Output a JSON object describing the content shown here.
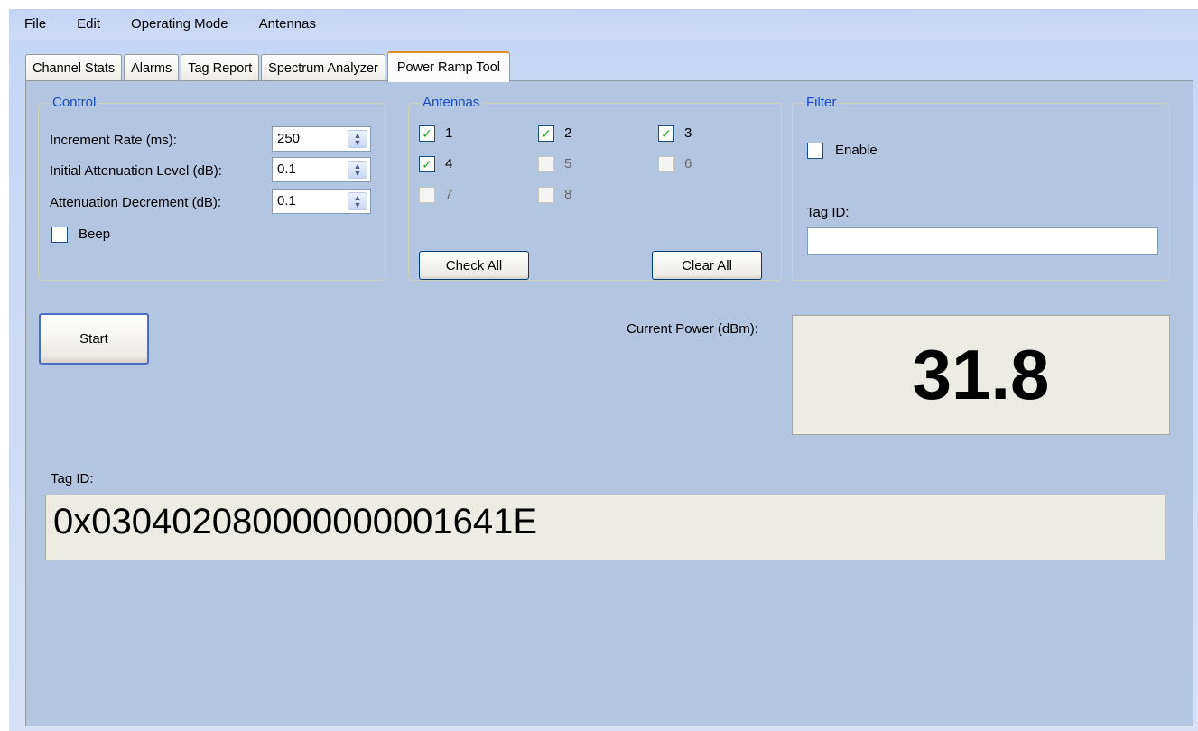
{
  "menu": [
    "File",
    "Edit",
    "Operating Mode",
    "Antennas"
  ],
  "tabs": [
    "Channel Stats",
    "Alarms",
    "Tag Report",
    "Spectrum Analyzer",
    "Power Ramp Tool"
  ],
  "control": {
    "title": "Control",
    "increment_rate_label": "Increment Rate (ms):",
    "increment_rate_value": "250",
    "initial_atten_label": "Initial Attenuation Level (dB):",
    "initial_atten_value": "0.1",
    "atten_decrement_label": "Attenuation Decrement (dB):",
    "atten_decrement_value": "0.1",
    "beep_label": "Beep"
  },
  "antennas": {
    "title": "Antennas",
    "items": [
      {
        "label": "1",
        "checked": true,
        "enabled": true
      },
      {
        "label": "2",
        "checked": true,
        "enabled": true
      },
      {
        "label": "3",
        "checked": true,
        "enabled": true
      },
      {
        "label": "4",
        "checked": true,
        "enabled": true
      },
      {
        "label": "5",
        "checked": false,
        "enabled": false
      },
      {
        "label": "6",
        "checked": false,
        "enabled": false
      },
      {
        "label": "7",
        "checked": false,
        "enabled": false
      },
      {
        "label": "8",
        "checked": false,
        "enabled": false
      }
    ],
    "check_all": "Check All",
    "clear_all": "Clear All"
  },
  "filter": {
    "title": "Filter",
    "enable_label": "Enable",
    "tag_id_label": "Tag ID:",
    "tag_id_value": ""
  },
  "start_button": "Start",
  "current_power_label": "Current Power (dBm):",
  "current_power_value": "31.8",
  "tag_id_label": "Tag ID:",
  "tag_id_value": "0x030402080000000001641E"
}
